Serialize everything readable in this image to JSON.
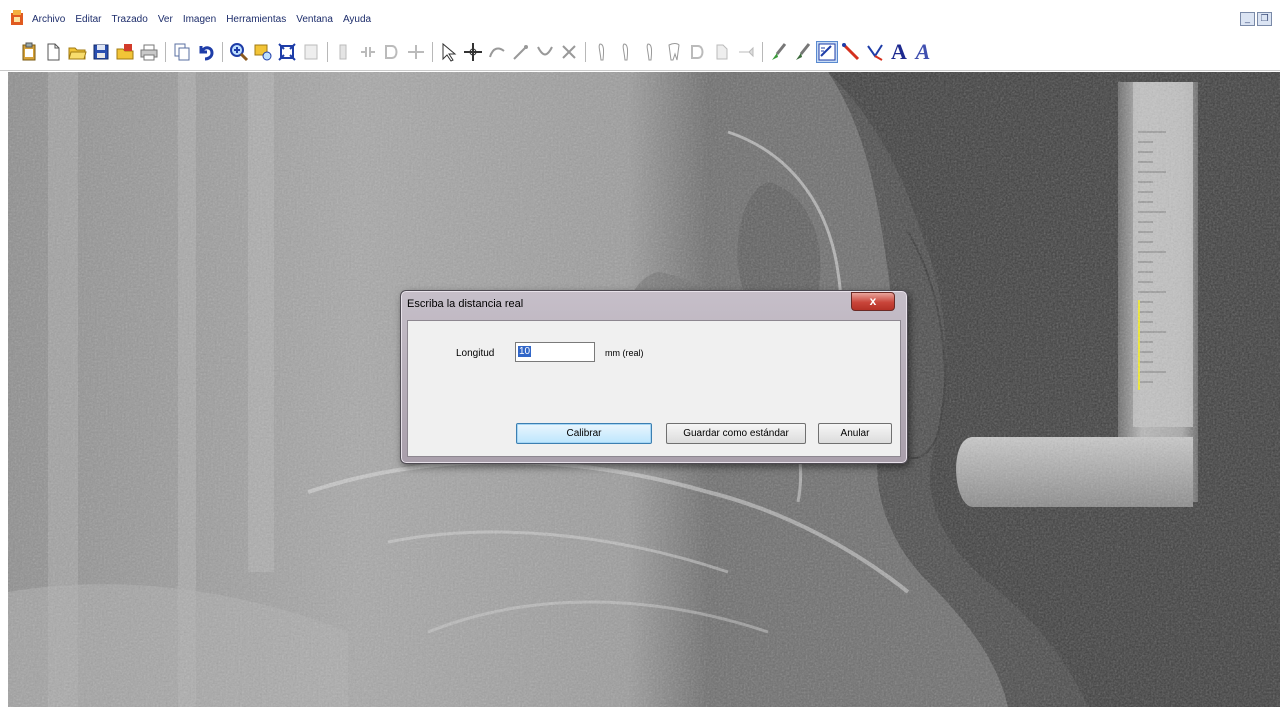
{
  "menu": {
    "items": [
      "Archivo",
      "Editar",
      "Trazado",
      "Ver",
      "Imagen",
      "Herramientas",
      "Ventana",
      "Ayuda"
    ]
  },
  "window_controls": {
    "minimize": "_",
    "restore": "❐"
  },
  "toolbar": {
    "icons": [
      "clipboard-icon",
      "new-document-icon",
      "open-folder-icon",
      "save-icon",
      "export-icon",
      "print-icon",
      "copy-icon",
      "undo-icon",
      "zoom-icon",
      "image-select-icon",
      "fit-window-icon",
      "blank-icon",
      "tool-disabled-1-icon",
      "tool-disabled-2-icon",
      "tool-disabled-3-icon",
      "tool-disabled-4-icon",
      "arrow-cursor-icon",
      "crosshair-icon",
      "trace-1-icon",
      "trace-2-icon",
      "trace-3-icon",
      "trace-4-icon",
      "tooth-1-icon",
      "tooth-2-icon",
      "tooth-3-icon",
      "tooth-4-icon",
      "tooth-5-icon",
      "tooth-6-icon",
      "tooth-7-icon",
      "brush-1-icon",
      "brush-2-icon",
      "calibrate-icon",
      "line-icon",
      "angle-icon",
      "text-a-icon",
      "text-a-italic-icon"
    ],
    "text_a": "A"
  },
  "dialog": {
    "title": "Escriba la distancia real",
    "close": "x",
    "longitud_label": "Longitud",
    "longitud_value": "10",
    "unit_label": "mm (real)",
    "btn_calibrar": "Calibrar",
    "btn_guardar": "Guardar como estándar",
    "btn_anular": "Anular"
  },
  "colors": {
    "menu_text": "#1d2d6b",
    "accent_blue": "#3166c8",
    "close_red": "#c9453a",
    "ruler_yellow": "#f4ec2c"
  }
}
